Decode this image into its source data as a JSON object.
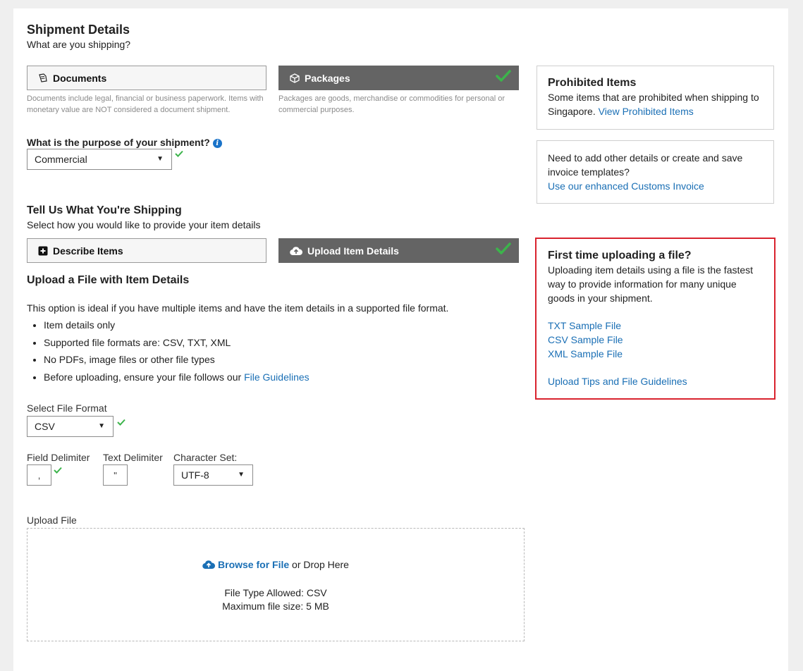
{
  "shipment": {
    "title": "Shipment Details",
    "subtitle": "What are you shipping?",
    "documents_label": "Documents",
    "documents_hint": "Documents include legal, financial or business paperwork. Items with monetary value are NOT considered a document shipment.",
    "packages_label": "Packages",
    "packages_hint": "Packages are goods, merchandise or commodities for personal or commercial purposes.",
    "purpose_label": "What is the purpose of your shipment?",
    "purpose_value": "Commercial"
  },
  "prohibited": {
    "title": "Prohibited Items",
    "text": "Some items that are prohibited when shipping to Singapore.",
    "link": "View Prohibited Items"
  },
  "invoice": {
    "text": "Need to add other details or create and save invoice templates?",
    "link": "Use our enhanced Customs Invoice"
  },
  "items": {
    "title": "Tell Us What You're Shipping",
    "subtitle": "Select how you would like to provide your item details",
    "describe_label": "Describe Items",
    "upload_label": "Upload Item Details"
  },
  "upload_section": {
    "title": "Upload a File with Item Details",
    "intro": "This option is ideal if you have multiple items and have the item details in a supported file format.",
    "bullets": [
      "Item details only",
      "Supported file formats are: CSV, TXT, XML",
      "No PDFs, image files or other file types"
    ],
    "bullet4_prefix": "Before uploading, ensure your file follows our",
    "bullet4_link": "File Guidelines",
    "format_label": "Select File Format",
    "format_value": "CSV",
    "field_delim_label": "Field Delimiter",
    "field_delim_value": ",",
    "text_delim_label": "Text Delimiter",
    "text_delim_value": "\"",
    "charset_label": "Character Set:",
    "charset_value": "UTF-8",
    "upload_label": "Upload File",
    "browse_link": "Browse for File",
    "drop_text": "or Drop Here",
    "allowed": "File Type Allowed: CSV",
    "max_size": "Maximum file size: 5 MB"
  },
  "first_time": {
    "title": "First time uploading a file?",
    "text": "Uploading item details using a file is the fastest way to provide information for many unique goods in your shipment.",
    "txt_link": "TXT Sample File",
    "csv_link": "CSV Sample File",
    "xml_link": "XML Sample File",
    "tips_link": "Upload Tips and File Guidelines"
  },
  "colors": {
    "link": "#1a6fb5",
    "selected_tile": "#646464",
    "check": "#3cb44b",
    "highlight": "#d9232e"
  },
  "icons": [
    "documents-icon",
    "package-icon",
    "plus-square-icon",
    "cloud-upload-icon",
    "check-icon",
    "info-icon",
    "caret-down-icon"
  ]
}
